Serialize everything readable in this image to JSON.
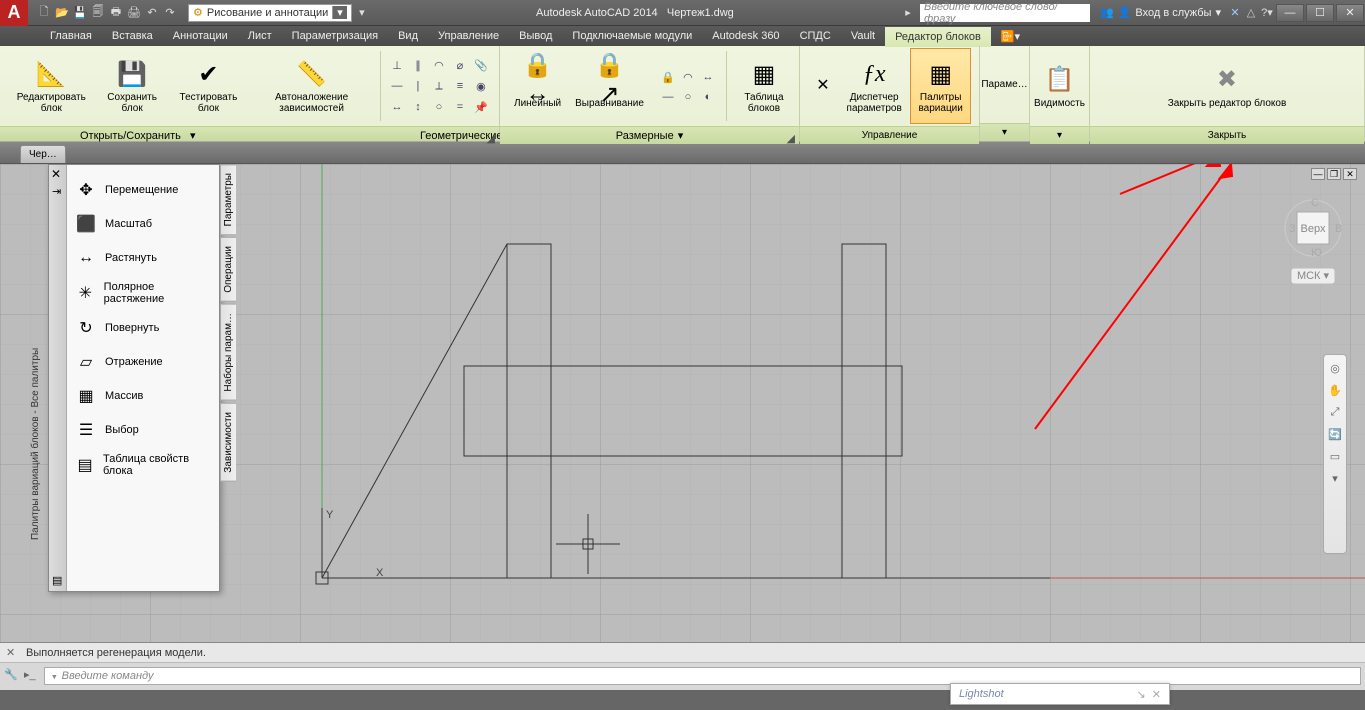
{
  "title": {
    "app": "Autodesk AutoCAD 2014",
    "doc": "Чертеж1.dwg"
  },
  "workspace": "Рисование и аннотации",
  "search_placeholder": "Введите ключевое слово/фразу",
  "login": "Вход в службы",
  "menu": [
    "Главная",
    "Вставка",
    "Аннотации",
    "Лист",
    "Параметризация",
    "Вид",
    "Управление",
    "Вывод",
    "Подключаемые модули",
    "Autodesk 360",
    "СПДС",
    "Vault",
    "Редактор блоков"
  ],
  "active_menu": 12,
  "ribbon": {
    "p0": {
      "title": "Открыть/Сохранить",
      "btns": [
        "Редактировать блок",
        "Сохранить блок",
        "Тестировать блок",
        "Автоналожение зависимостей"
      ]
    },
    "p1": {
      "title": "Геометрические"
    },
    "p2": {
      "title": "Размерные",
      "btns": [
        "Линейный",
        "Выравнивание"
      ]
    },
    "p3_btn": "Таблица блоков",
    "p4": {
      "title": "Управление",
      "btns": [
        "Диспетчер параметров",
        "Палитры вариации"
      ],
      "fx": "ƒx"
    },
    "p5": "Параме…",
    "p6": "Видимость",
    "p7": {
      "title": "Закрыть",
      "btn": "Закрыть редактор блоков"
    }
  },
  "doc_tab": "Чер…",
  "palette": {
    "title": "Палитры вариаций блоков - Все палитры",
    "items": [
      "Перемещение",
      "Масштаб",
      "Растянуть",
      "Полярное растяжение",
      "Повернуть",
      "Отражение",
      "Массив",
      "Выбор",
      "Таблица свойств блока"
    ],
    "tabs": [
      "Параметры",
      "Операции",
      "Наборы парам…",
      "Зависимости"
    ]
  },
  "axes": {
    "x": "X",
    "y": "Y"
  },
  "viewcube": {
    "face": "Верх",
    "wcs": "МСК"
  },
  "cmd": {
    "hist": "Выполняется регенерация модели.",
    "prompt": "Введите команду"
  },
  "lightshot": "Lightshot"
}
